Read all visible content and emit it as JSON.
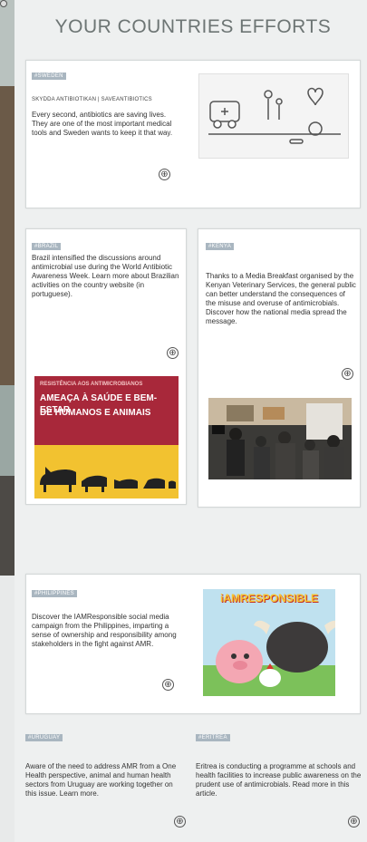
{
  "page": {
    "title": "YOUR COUNTRIES EFFORTS"
  },
  "sweden": {
    "tag": "#SWEDEN",
    "subtag": "SKYDDA ANTIBIOTIKAN | SAVEANTIBIOTICS",
    "text": "Every second, antibiotics are saving lives. They are one of the most important medical tools and Sweden wants to keep it that way."
  },
  "brazil": {
    "tag": "#BRAZIL",
    "text": "Brazil intensified the discussions around antimicrobial use during the World Antibiotic Awareness Week. Learn more about Brazilian activities on the country website (in portuguese).",
    "banner_small": "RESISTÊNCIA AOS ANTIMICROBIANOS",
    "banner_line1": "AMEAÇA À SAÚDE E BEM-ESTAR",
    "banner_line2": "DE HUMANOS E ANIMAIS"
  },
  "kenya": {
    "tag": "#KENYA",
    "text": "Thanks to a Media Breakfast organised by the Kenyan Veterinary Services, the general public can better understand the consequences of the misuse and overuse of antimicrobials. Discover how the national media spread the message."
  },
  "philippines": {
    "tag": "#PHILIPPINES",
    "text": "Discover the IAMResponsible social media campaign from the Philippines, imparting a sense of ownership and responsibility among stakeholders in the fight against AMR.",
    "logo_text": "iAMRESPONSIBLE"
  },
  "uruguay": {
    "tag": "#URUGUAY",
    "text": "Aware of the need to address AMR from a One Health perspective, animal and human health sectors from Uruguay are working together on this issue. Learn more."
  },
  "eritrea": {
    "tag": "#ERITREA",
    "text": "Eritrea is conducting a programme at schools and health facilities to increase public awareness on the prudent use of antimicrobials. Read more in this article."
  },
  "icons": {
    "plus": "⊕",
    "plus_name": "circle-plus-icon"
  },
  "colors": {
    "tag_bg": "#a9b6c0",
    "banner_red": "#a8283a",
    "banner_yellow": "#f2c230",
    "title": "#6d7574"
  }
}
